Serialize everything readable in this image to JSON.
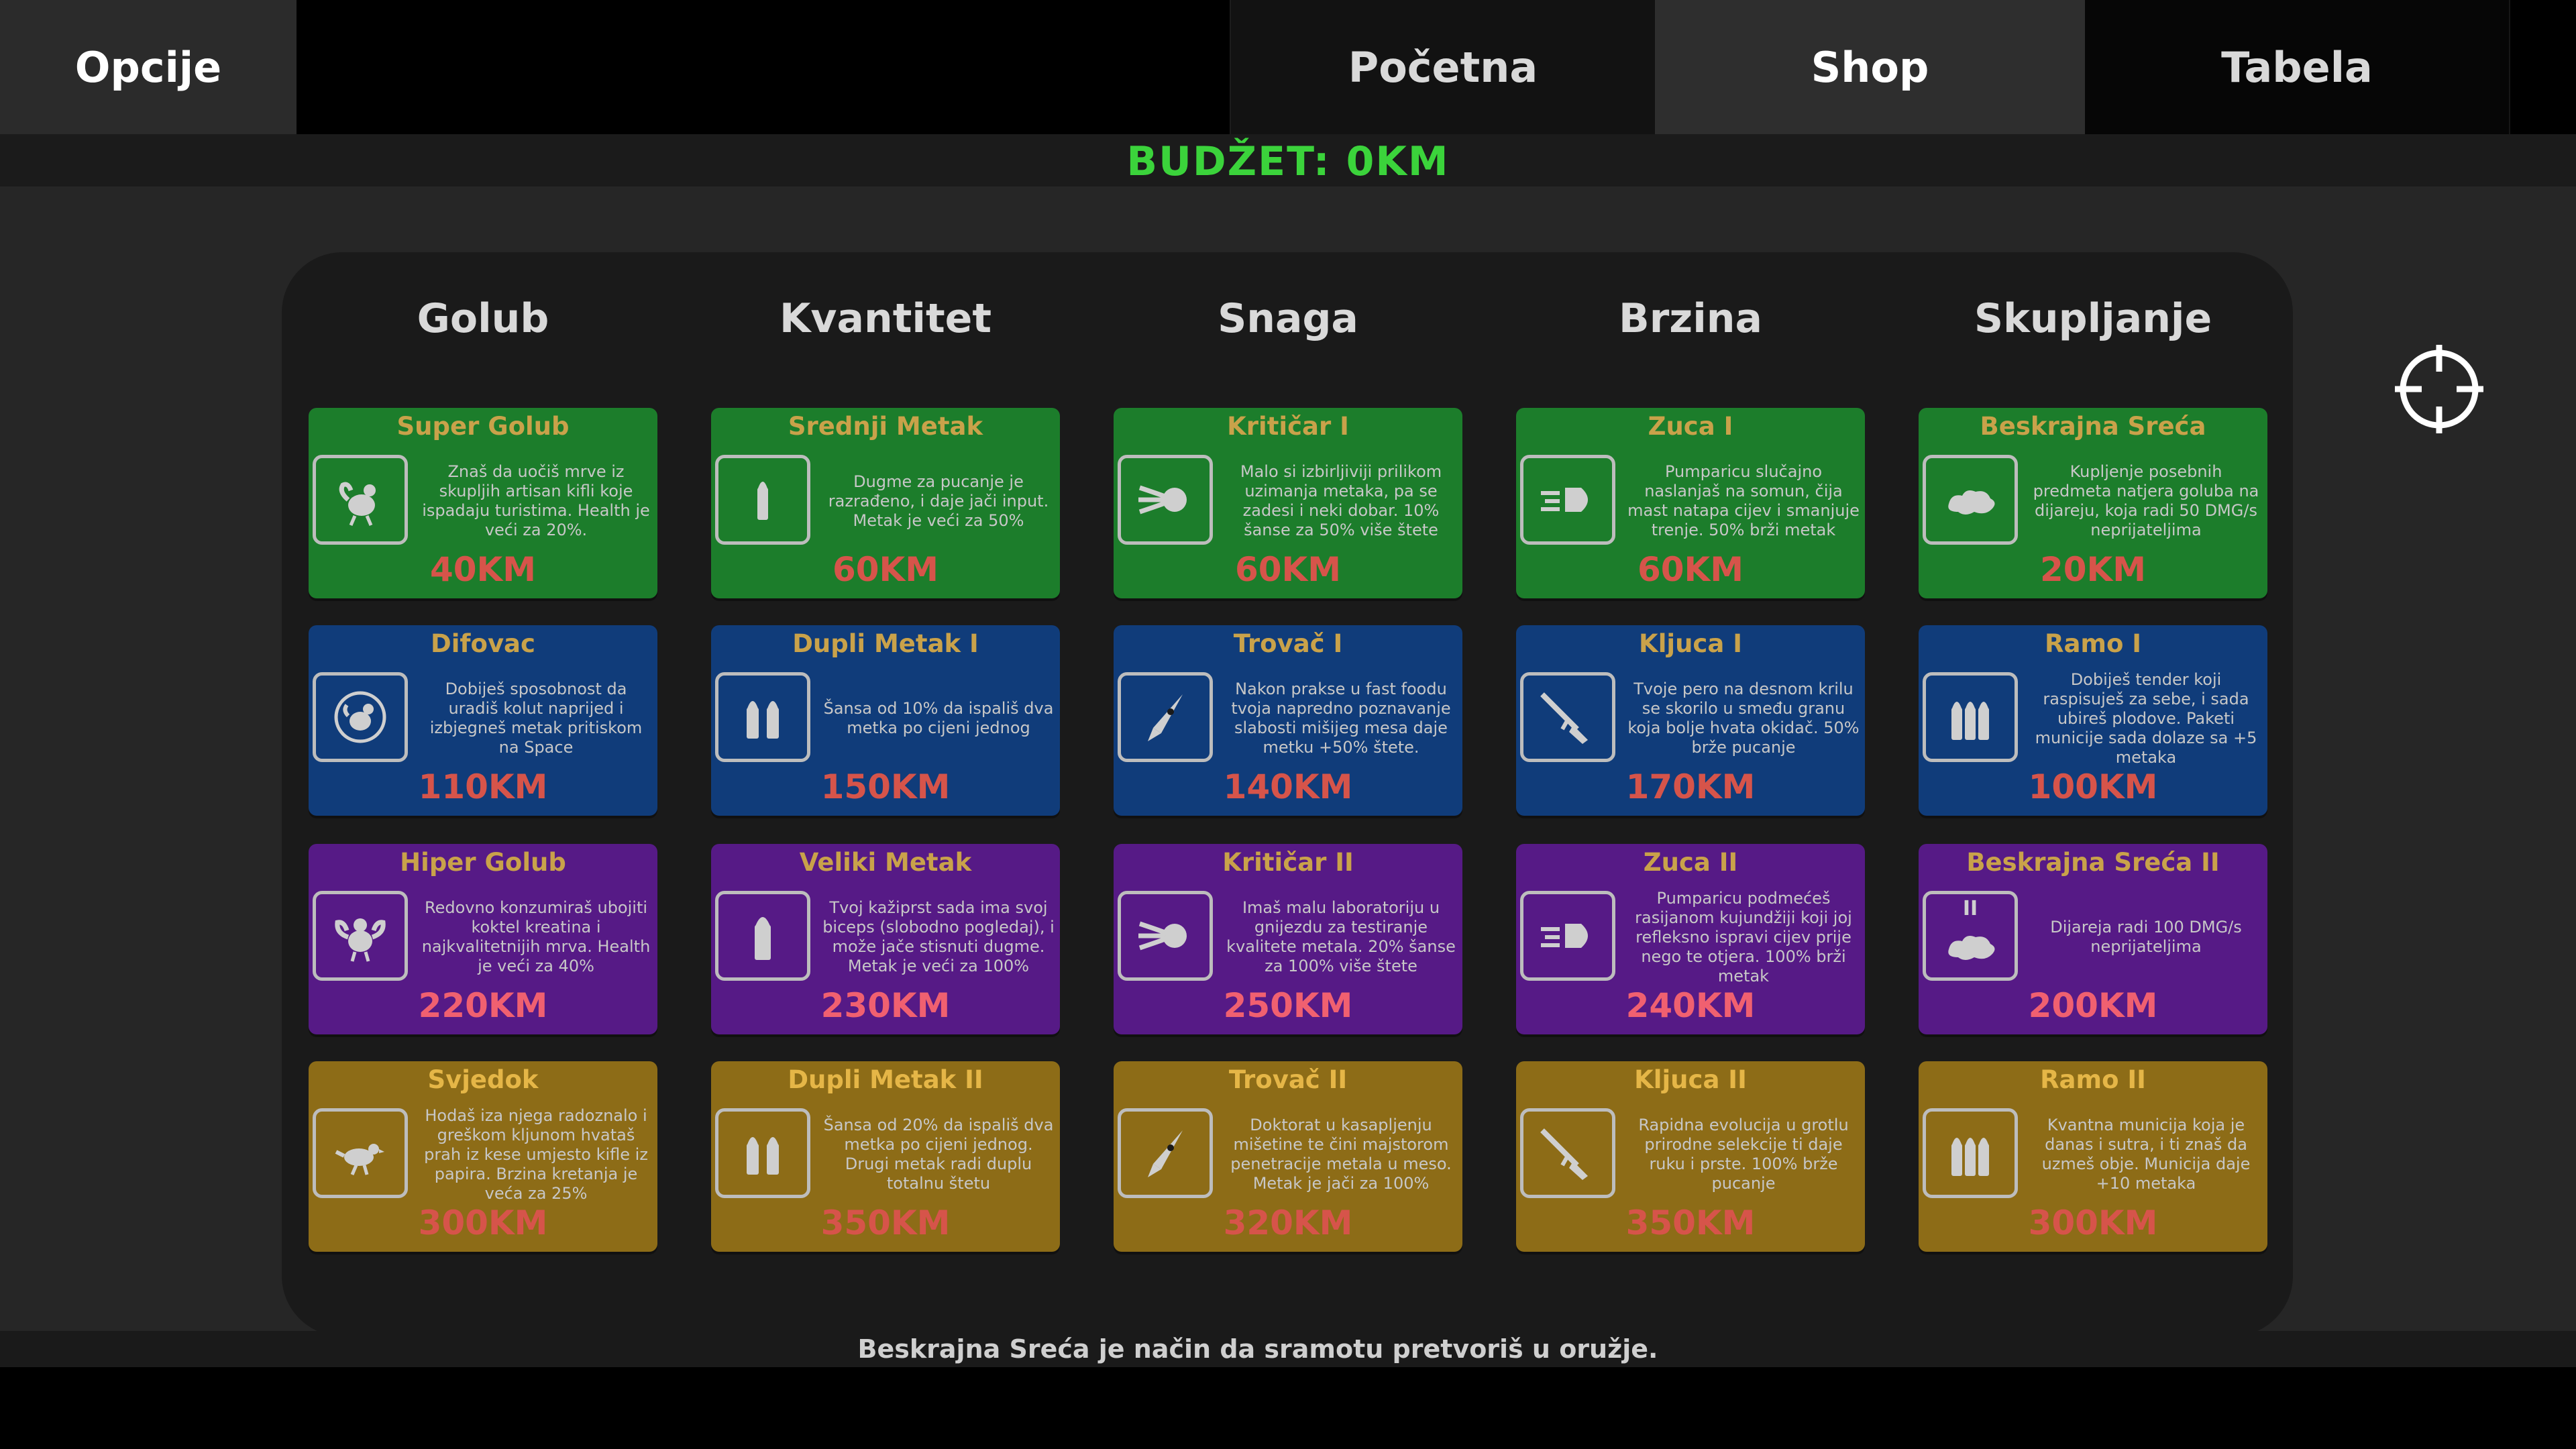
{
  "nav": {
    "options": "Opcije",
    "home": "Početna",
    "shop": "Shop",
    "table": "Tabela"
  },
  "budget": "BUDŽET: 0KM",
  "columns": [
    "Golub",
    "Kvantitet",
    "Snaga",
    "Brzina",
    "Skupljanje"
  ],
  "cards": [
    [
      {
        "title": "Super Golub",
        "desc": "Znaš da uočiš mrve iz skupljih artisan kifli koje ispadaju turistima. Health je veći za 20%.",
        "price": "40KM",
        "icon": "muscle-pigeon-icon"
      },
      {
        "title": "Srednji Metak",
        "desc": "Dugme za pucanje je razrađeno, i daje jači input. Metak je veći za 50%",
        "price": "60KM",
        "icon": "bullet-icon"
      },
      {
        "title": "Kritičar I",
        "desc": "Malo si izbirljiviji prilikom uzimanja metaka, pa se zadesi i neki dobar. 10% šanse za 50% više štete",
        "price": "60KM",
        "icon": "fireball-icon"
      },
      {
        "title": "Zuca I",
        "desc": "Pumparicu slučajno naslanjaš na somun, čija mast natapa cijev i smanjuje trenje. 50% brži metak",
        "price": "60KM",
        "icon": "speeding-bullet-icon"
      },
      {
        "title": "Beskrajna Sreća",
        "desc": "Kupljenje posebnih predmeta natjera goluba na dijareju, koja radi 50 DMG/s neprijateljima",
        "price": "20KM",
        "icon": "splat-icon"
      }
    ],
    [
      {
        "title": "Difovac",
        "desc": "Dobiješ sposobnost da uradiš kolut naprijed i izbjegneš metak pritiskom na Space",
        "price": "110KM",
        "icon": "dodging-pigeon-icon"
      },
      {
        "title": "Dupli Metak I",
        "desc": "Šansa od 10% da ispališ dva metka po cijeni jednog",
        "price": "150KM",
        "icon": "double-bullet-icon"
      },
      {
        "title": "Trovač I",
        "desc": "Nakon prakse u fast foodu tvoja napredno poznavanje slabosti mišijeg mesa daje metku +50% štete.",
        "price": "140KM",
        "icon": "rocket-icon"
      },
      {
        "title": "Kljuca I",
        "desc": "Tvoje pero na desnom krilu se skorilo u smeđu granu koja bolje hvata okidač. 50% brže pucanje",
        "price": "170KM",
        "icon": "shotgun-icon"
      },
      {
        "title": "Ramo I",
        "desc": "Dobiješ tender koji raspisuješ za sebe, i sada ubireš plodove. Paketi municije sada dolaze sa +5 metaka",
        "price": "100KM",
        "icon": "ammo-pack-icon"
      }
    ],
    [
      {
        "title": "Hiper Golub",
        "desc": "Redovno konzumiraš ubojiti koktel kreatina i najkvalitetnijih mrva. Health je veći za 40%",
        "price": "220KM",
        "icon": "buff-pigeon-icon"
      },
      {
        "title": "Veliki Metak",
        "desc": "Tvoj kažiprst sada ima svoj biceps (slobodno pogledaj), i može jače stisnuti dugme. Metak je veći za 100%",
        "price": "230KM",
        "icon": "big-bullet-icon"
      },
      {
        "title": "Kritičar II",
        "desc": "Imaš malu laboratoriju u gnijezdu za testiranje kvalitete metala. 20% šanse za 100% više štete",
        "price": "250KM",
        "icon": "fireball-icon"
      },
      {
        "title": "Zuca II",
        "desc": "Pumparicu podmećeš rasijanom kujundžiji koji joj refleksno ispravi cijev prije nego te otjera. 100% brži metak",
        "price": "240KM",
        "icon": "speeding-bullet-icon"
      },
      {
        "title": "Beskrajna Sreća II",
        "desc": "Dijareja radi 100 DMG/s neprijateljima",
        "price": "200KM",
        "icon": "splat-icon",
        "badge": "II"
      }
    ],
    [
      {
        "title": "Svjedok",
        "desc": "Hodaš iza njega radoznalo i greškom kljunom hvataš prah iz kese umjesto kifle iz papira. Brzina kretanja je veća za 25%",
        "price": "300KM",
        "icon": "walking-pigeon-icon"
      },
      {
        "title": "Dupli Metak II",
        "desc": "Šansa od 20% da ispališ dva metka po cijeni jednog. Drugi metak radi duplu totalnu štetu",
        "price": "350KM",
        "icon": "double-bullet-icon"
      },
      {
        "title": "Trovač II",
        "desc": "Doktorat u kasapljenju mišetine te čini majstorom penetracije metala u meso. Metak je jači za 100%",
        "price": "320KM",
        "icon": "rocket-icon"
      },
      {
        "title": "Kljuca II",
        "desc": "Rapidna evolucija u grotlu prirodne selekcije ti daje ruku i prste. 100% brže pucanje",
        "price": "350KM",
        "icon": "shotgun-icon"
      },
      {
        "title": "Ramo II",
        "desc": "Kvantna municija koja je danas i sutra, i ti znaš da uzmeš obje. Municija daje +10 metaka",
        "price": "300KM",
        "icon": "ammo-pack-icon"
      }
    ]
  ],
  "tip": "Beskrajna Sreća je način da sramotu pretvoriš u oružje.",
  "colors": {
    "budget": "#3bd33b",
    "row1": "#1c7d2b",
    "row2": "#103c7a",
    "row3": "#561a86",
    "row4": "#8d6c17",
    "price": "#d6544a"
  }
}
